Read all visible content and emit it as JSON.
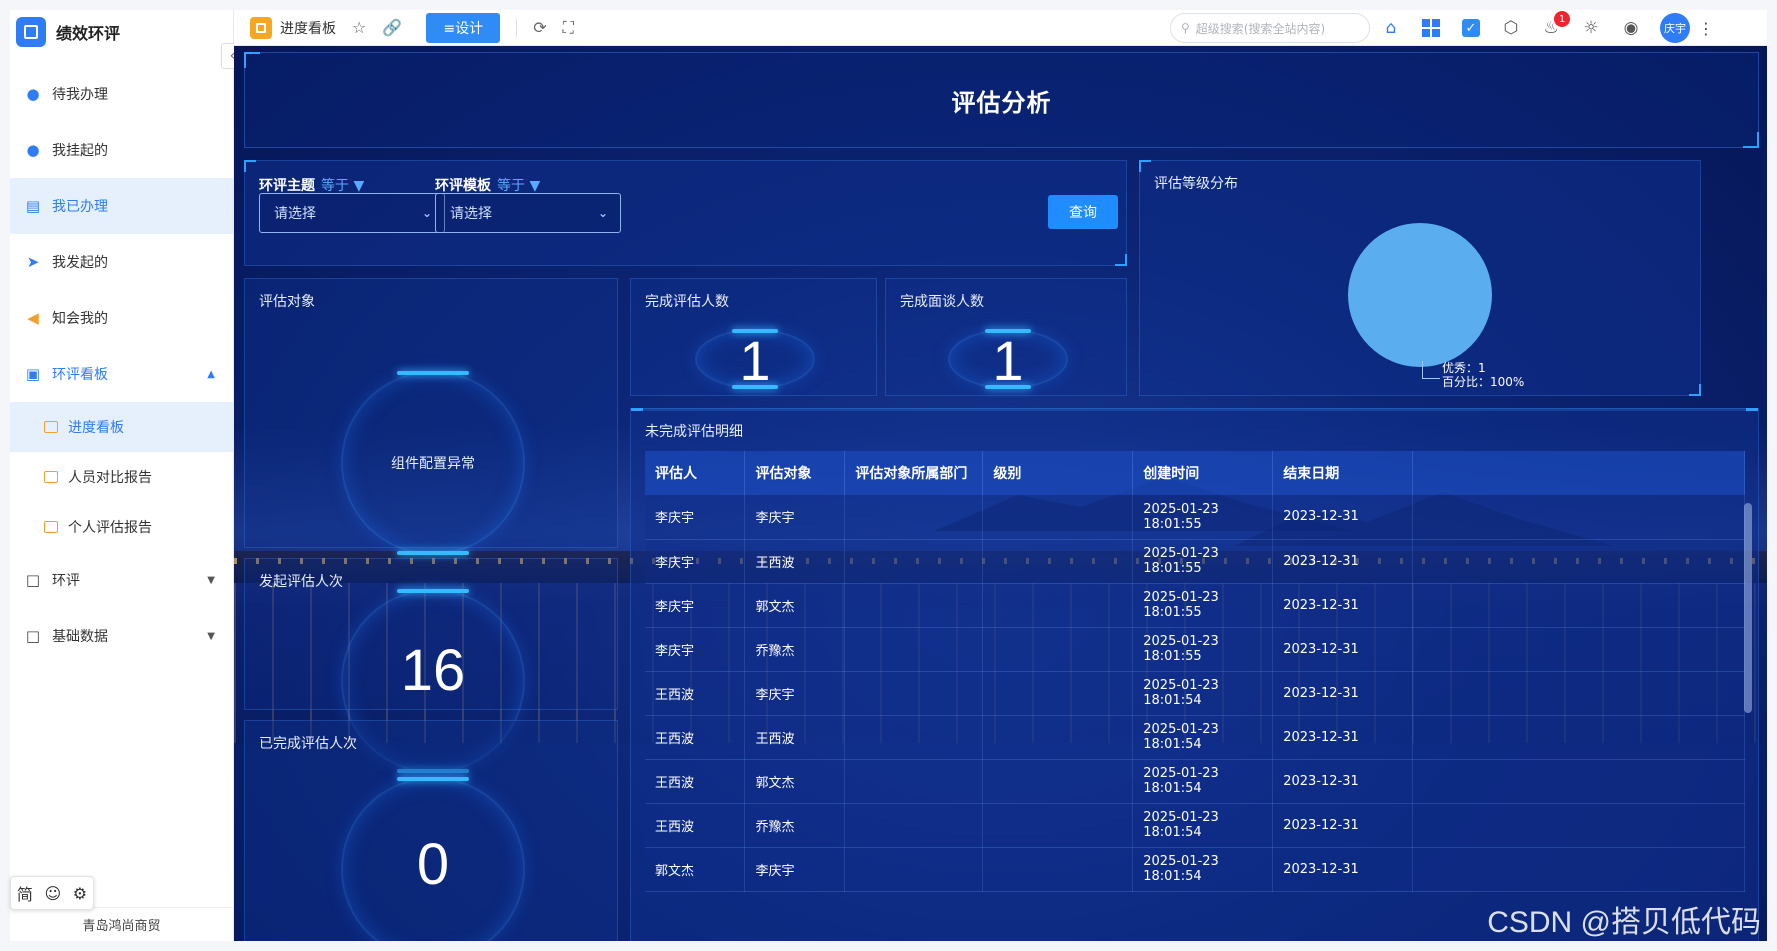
{
  "sidebar": {
    "brand": "绩效环评",
    "collapse_icon": "«",
    "items": [
      {
        "label": "待我办理",
        "icon": "user-icon"
      },
      {
        "label": "我挂起的",
        "icon": "user-pause-icon"
      },
      {
        "label": "我已办理",
        "icon": "done-list-icon"
      },
      {
        "label": "我发起的",
        "icon": "send-icon"
      },
      {
        "label": "知会我的",
        "icon": "megaphone-icon"
      },
      {
        "label": "环评看板",
        "icon": "board-icon"
      }
    ],
    "sub_items": [
      {
        "label": "进度看板"
      },
      {
        "label": "人员对比报告"
      },
      {
        "label": "个人评估报告"
      }
    ],
    "groups": [
      {
        "label": "环评"
      },
      {
        "label": "基础数据"
      }
    ],
    "footer": "青岛鸿尚商贸",
    "float_tools": {
      "simplified": "简",
      "emoji": "☺",
      "settings": "⚙"
    }
  },
  "topbar": {
    "tab_label": "进度看板",
    "design_label": "≡设计",
    "search_placeholder": "超级搜索(搜索全站内容)",
    "notification_count": "1",
    "avatar_text": "庆宇"
  },
  "dashboard": {
    "title": "评估分析",
    "filters": {
      "theme_label": "环评主题",
      "theme_op": "等于",
      "theme_value": "请选择",
      "template_label": "环评模板",
      "template_op": "等于",
      "template_value": "请选择",
      "query_label": "查询"
    },
    "cards": {
      "target_title": "评估对象",
      "target_error": "组件配置异常",
      "launched_title": "发起评估人次",
      "launched_value": "16",
      "completed_times_title": "已完成评估人次",
      "completed_times_value": "0",
      "completed_people_title": "完成评估人数",
      "completed_people_value": "1",
      "interview_title": "完成面谈人数",
      "interview_value": "1"
    },
    "pie": {
      "title": "评估等级分布",
      "label_line1": "优秀：1",
      "label_line2": "百分比：100%",
      "color": "#5aaef0"
    },
    "table": {
      "title": "未完成评估明细",
      "columns": [
        "评估人",
        "评估对象",
        "评估对象所属部门",
        "级别",
        "创建时间",
        "结束日期"
      ],
      "rows": [
        [
          "李庆宇",
          "李庆宇",
          "",
          "",
          "2025-01-23 18:01:55",
          "2023-12-31"
        ],
        [
          "李庆宇",
          "王西波",
          "",
          "",
          "2025-01-23 18:01:55",
          "2023-12-31"
        ],
        [
          "李庆宇",
          "郭文杰",
          "",
          "",
          "2025-01-23 18:01:55",
          "2023-12-31"
        ],
        [
          "李庆宇",
          "乔豫杰",
          "",
          "",
          "2025-01-23 18:01:55",
          "2023-12-31"
        ],
        [
          "王西波",
          "李庆宇",
          "",
          "",
          "2025-01-23 18:01:54",
          "2023-12-31"
        ],
        [
          "王西波",
          "王西波",
          "",
          "",
          "2025-01-23 18:01:54",
          "2023-12-31"
        ],
        [
          "王西波",
          "郭文杰",
          "",
          "",
          "2025-01-23 18:01:54",
          "2023-12-31"
        ],
        [
          "王西波",
          "乔豫杰",
          "",
          "",
          "2025-01-23 18:01:54",
          "2023-12-31"
        ],
        [
          "郭文杰",
          "李庆宇",
          "",
          "",
          "2025-01-23 18:01:54",
          "2023-12-31"
        ]
      ]
    }
  },
  "watermark": "CSDN @搭贝低代码"
}
